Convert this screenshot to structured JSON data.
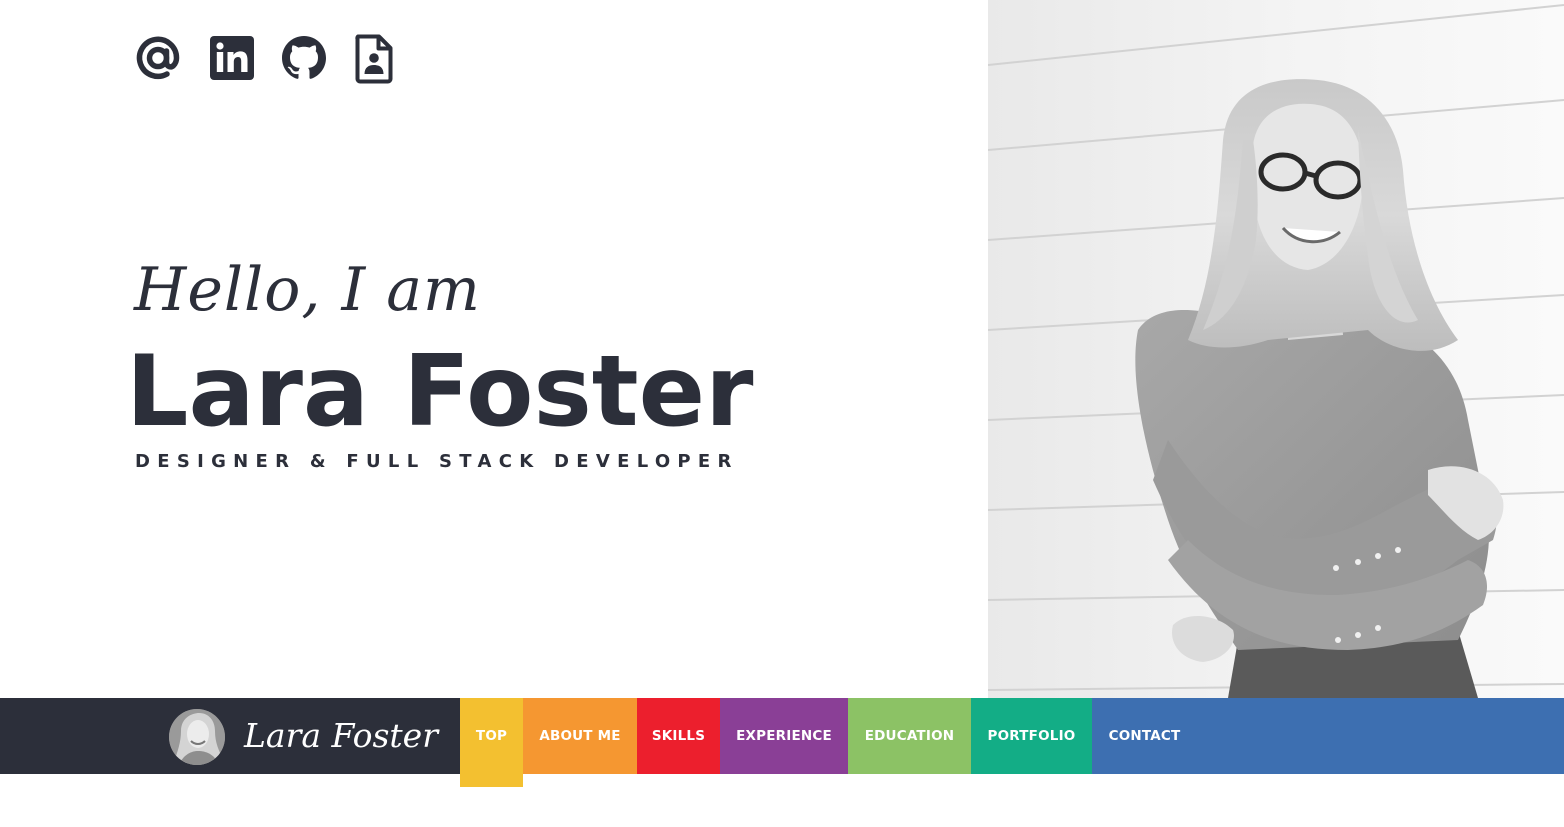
{
  "social": {
    "items": [
      {
        "icon": "at-sign-icon",
        "label": "Email"
      },
      {
        "icon": "linkedin-icon",
        "label": "LinkedIn"
      },
      {
        "icon": "github-icon",
        "label": "GitHub"
      },
      {
        "icon": "resume-icon",
        "label": "Résumé"
      }
    ],
    "color": "#2c2f3a"
  },
  "hero": {
    "greeting": "Hello, I am",
    "name": "Lara Foster",
    "role": "DESIGNER & FULL STACK DEVELOPER"
  },
  "photo": {
    "style": "black-and-white portrait"
  },
  "navbar": {
    "brand_name": "Lara Foster",
    "brand_bg": "#2c2f3a",
    "bar_bg": "#3d6fb1",
    "active_item": "TOP",
    "items": [
      {
        "label": "TOP",
        "color": "#f3c030"
      },
      {
        "label": "ABOUT ME",
        "color": "#f59731"
      },
      {
        "label": "SKILLS",
        "color": "#ec1f2d"
      },
      {
        "label": "EXPERIENCE",
        "color": "#8a3f96"
      },
      {
        "label": "EDUCATION",
        "color": "#8cc265"
      },
      {
        "label": "PORTFOLIO",
        "color": "#13ad86"
      },
      {
        "label": "CONTACT",
        "color": "#3d6fb1"
      }
    ]
  }
}
